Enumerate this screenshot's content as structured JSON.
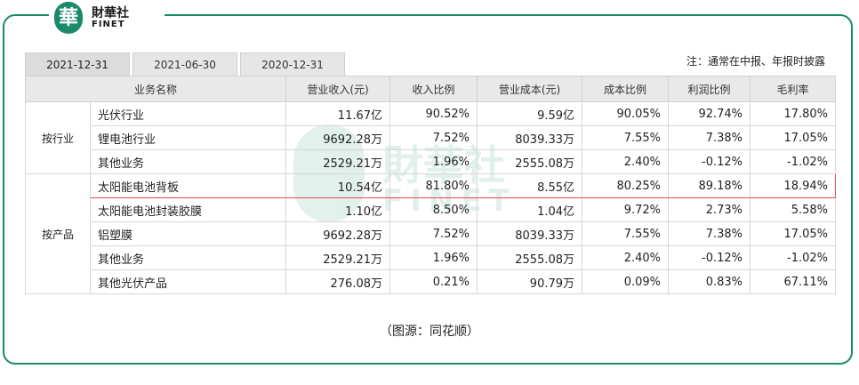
{
  "logo": {
    "badge": "華",
    "cn": "財華社",
    "en": "FINET"
  },
  "tabs": [
    "2021-12-31",
    "2021-06-30",
    "2020-12-31"
  ],
  "note": "注：通常在中报、年报时披露",
  "headers": [
    "业务名称",
    "营业收入(元)",
    "收入比例",
    "营业成本(元)",
    "成本比例",
    "利润比例",
    "毛利率"
  ],
  "groups": {
    "industry": "按行业",
    "product": "按产品"
  },
  "rows": [
    [
      "光伏行业",
      "11.67亿",
      "90.52%",
      "9.59亿",
      "90.05%",
      "92.74%",
      "17.80%"
    ],
    [
      "锂电池行业",
      "9692.28万",
      "7.52%",
      "8039.33万",
      "7.55%",
      "7.38%",
      "17.05%"
    ],
    [
      "其他业务",
      "2529.21万",
      "1.96%",
      "2555.08万",
      "2.40%",
      "-0.12%",
      "-1.02%"
    ],
    [
      "太阳能电池背板",
      "10.54亿",
      "81.80%",
      "8.55亿",
      "80.25%",
      "89.18%",
      "18.94%"
    ],
    [
      "太阳能电池封装胶膜",
      "1.10亿",
      "8.50%",
      "1.04亿",
      "9.72%",
      "2.73%",
      "5.58%"
    ],
    [
      "铝塑膜",
      "9692.28万",
      "7.52%",
      "8039.33万",
      "7.55%",
      "7.38%",
      "17.05%"
    ],
    [
      "其他业务",
      "2529.21万",
      "1.96%",
      "2555.08万",
      "2.40%",
      "-0.12%",
      "-1.02%"
    ],
    [
      "其他光伏产品",
      "276.08万",
      "0.21%",
      "90.79万",
      "0.09%",
      "0.83%",
      "67.11%"
    ]
  ],
  "watermark": {
    "cn": "財華社",
    "en": "FINET"
  },
  "caption": "（图源：同花顺）",
  "colors": {
    "brand": "#1a8a6a",
    "highlight": "#e04a4a",
    "header_bg": "#e9e9e9"
  }
}
